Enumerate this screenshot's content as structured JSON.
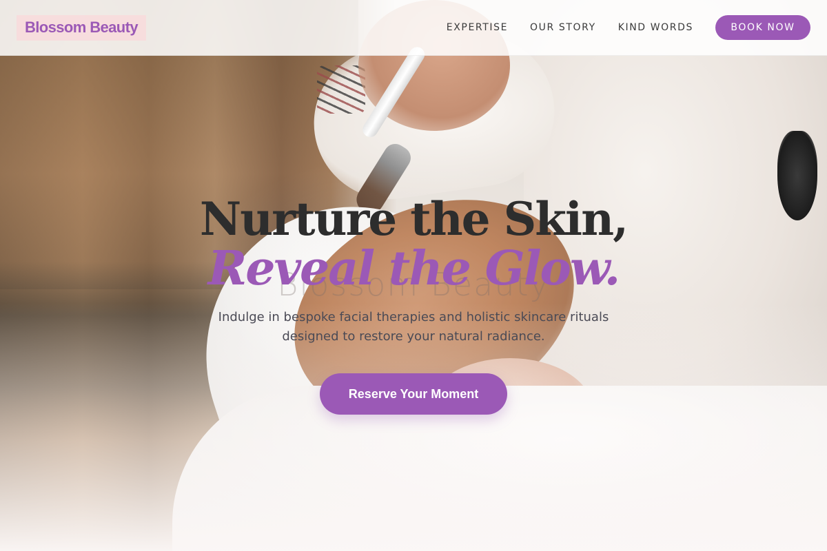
{
  "brand": {
    "name": "Blossom Beauty",
    "accent_color": "#9b59b6",
    "logo_bg_color": "#f8dbdc"
  },
  "nav": {
    "items": [
      {
        "label": "EXPERTISE"
      },
      {
        "label": "OUR STORY"
      },
      {
        "label": "KIND WORDS"
      }
    ],
    "cta_label": "BOOK NOW"
  },
  "hero": {
    "headline_line1": "Nurture the Skin,",
    "headline_line2": "Reveal the Glow.",
    "ghost_text": "Blossom Beauty",
    "subtitle": "Indulge in bespoke facial therapies and holistic skincare rituals designed to restore your natural radiance.",
    "cta_label": "Reserve Your Moment",
    "background_image": "spa-facial-treatment-photo"
  }
}
